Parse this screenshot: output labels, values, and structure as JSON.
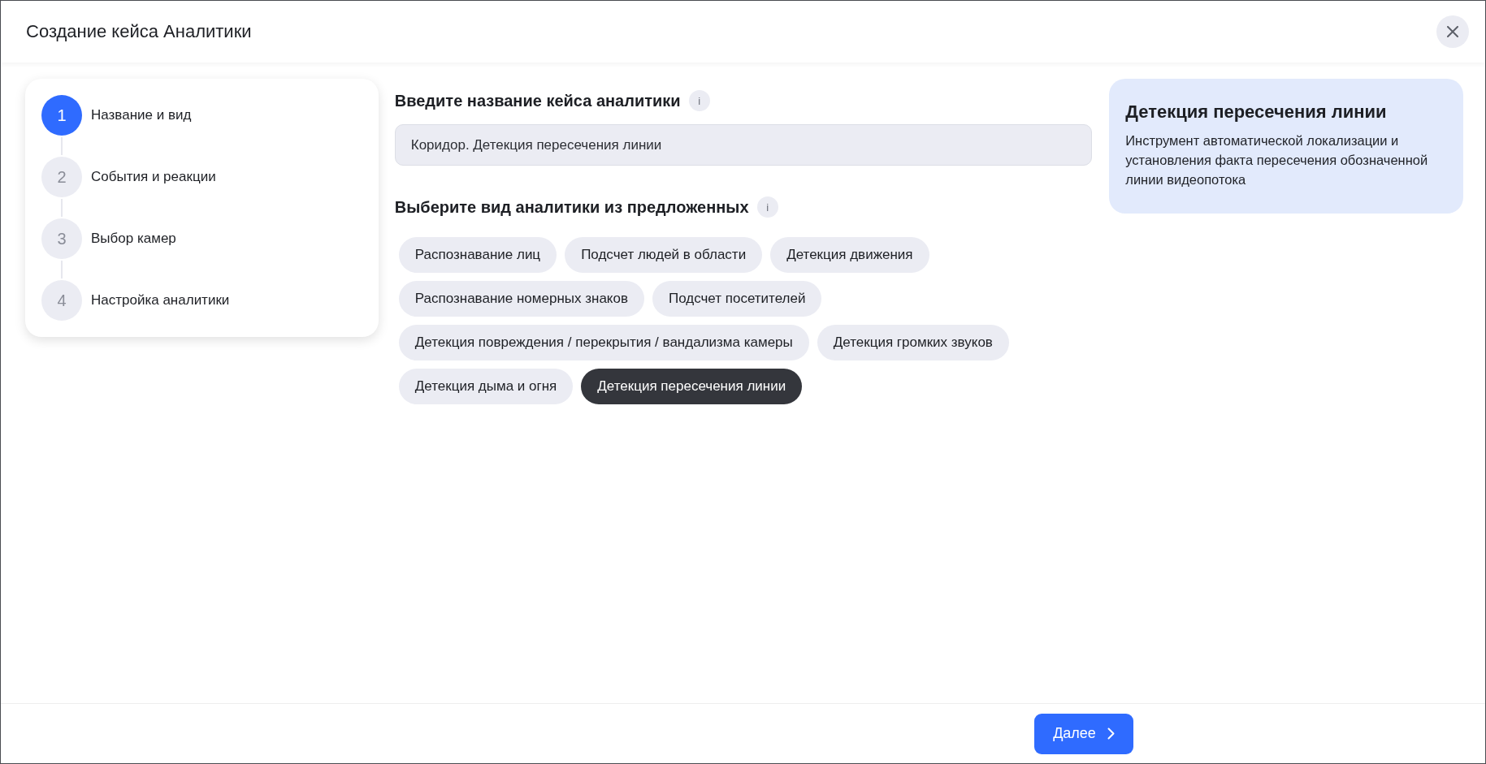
{
  "window": {
    "title": "Создание кейса Аналитики"
  },
  "steps": [
    {
      "number": "1",
      "label": "Название и вид",
      "selected": true
    },
    {
      "number": "2",
      "label": "События и реакции",
      "selected": false
    },
    {
      "number": "3",
      "label": "Выбор камер",
      "selected": false
    },
    {
      "number": "4",
      "label": "Настройка аналитики",
      "selected": false
    }
  ],
  "name_section": {
    "heading": "Введите название кейса аналитики",
    "info": "i",
    "value": "Коридор. Детекция пересечения линии"
  },
  "type_section": {
    "heading": "Выберите вид аналитики из предложенных",
    "info": "i",
    "options": [
      {
        "label": "Распознавание лиц",
        "selected": false
      },
      {
        "label": "Подсчет людей в области",
        "selected": false
      },
      {
        "label": "Детекция движения",
        "selected": false
      },
      {
        "label": "Распознавание номерных знаков",
        "selected": false
      },
      {
        "label": "Подсчет посетителей",
        "selected": false
      },
      {
        "label": "Детекция повреждения / перекрытия / вандализма камеры",
        "selected": false
      },
      {
        "label": "Детекция громких звуков",
        "selected": false
      },
      {
        "label": "Детекция дыма и огня",
        "selected": false
      },
      {
        "label": "Детекция пересечения линии",
        "selected": true
      }
    ]
  },
  "info_card": {
    "title": "Детекция пересечения линии",
    "description": "Инструмент автоматической локализации и установления факта пересечения обозначенной линии видеопотока"
  },
  "footer": {
    "next_button": "Далее"
  }
}
